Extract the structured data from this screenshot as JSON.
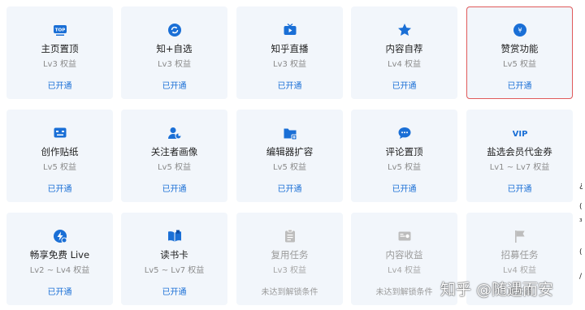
{
  "colors": {
    "accent": "#1a6fd6",
    "card_bg": "#f2f6fb",
    "disabled": "#bdbdbd",
    "highlight_border": "#e05a5a"
  },
  "cards": [
    {
      "name": "主页置顶",
      "level": "Lv3 权益",
      "status": "已开通",
      "icon": "top-badge-icon"
    },
    {
      "name": "知+自选",
      "level": "Lv3 权益",
      "status": "已开通",
      "icon": "refresh-icon"
    },
    {
      "name": "知乎直播",
      "level": "Lv3 权益",
      "status": "已开通",
      "icon": "tv-play-icon"
    },
    {
      "name": "内容自荐",
      "level": "Lv4 权益",
      "status": "已开通",
      "icon": "star-icon"
    },
    {
      "name": "赞赏功能",
      "level": "Lv5 权益",
      "status": "已开通",
      "icon": "coin-icon",
      "highlighted": true
    },
    {
      "name": "创作贴纸",
      "level": "Lv5 权益",
      "status": "已开通",
      "icon": "sticker-icon"
    },
    {
      "name": "关注者画像",
      "level": "Lv5 权益",
      "status": "已开通",
      "icon": "user-chart-icon"
    },
    {
      "name": "编辑器扩容",
      "level": "Lv5 权益",
      "status": "已开通",
      "icon": "folder-plus-icon"
    },
    {
      "name": "评论置顶",
      "level": "Lv5 权益",
      "status": "已开通",
      "icon": "comment-icon"
    },
    {
      "name": "盐选会员代金券",
      "level": "Lv1 ~ Lv7 权益",
      "status": "已开通",
      "icon": "vip-icon"
    },
    {
      "name": "畅享免费 Live",
      "level": "Lv2 ~ Lv4 权益",
      "status": "已开通",
      "icon": "live-icon"
    },
    {
      "name": "读书卡",
      "level": "Lv5 ~ Lv7 权益",
      "status": "已开通",
      "icon": "book-icon"
    },
    {
      "name": "复用任务",
      "level": "Lv3 权益",
      "status": "未达到解锁条件",
      "icon": "task-icon",
      "disabled": true
    },
    {
      "name": "内容收益",
      "level": "Lv4 权益",
      "status": "未达到解锁条件",
      "icon": "income-icon",
      "disabled": true
    },
    {
      "name": "招募任务",
      "level": "Lv4 权益",
      "status": "已开通",
      "icon": "flag-icon",
      "disabled": true
    }
  ],
  "watermark": "知乎 @随遇而安",
  "edge": [
    "¿",
    "(",
    "₃",
    "(",
    "/"
  ]
}
